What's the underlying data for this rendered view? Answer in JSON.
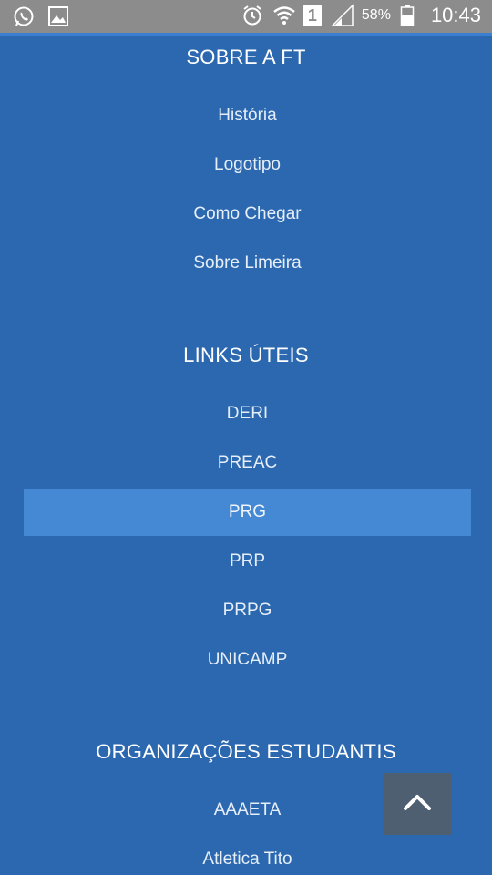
{
  "status_bar": {
    "battery": "58%",
    "time": "10:43",
    "sim": "1",
    "icons_left": [
      "whatsapp-icon",
      "gallery-icon"
    ],
    "icons_right": [
      "alarm-icon",
      "wifi-icon",
      "sim-icon",
      "signal-icon",
      "battery-icon"
    ]
  },
  "sections": {
    "sobre": {
      "title": "SOBRE A FT",
      "items": [
        "História",
        "Logotipo",
        "Como Chegar",
        "Sobre Limeira"
      ]
    },
    "links": {
      "title": "LINKS ÚTEIS",
      "items": [
        "DERI",
        "PREAC",
        "PRG",
        "PRP",
        "PRPG",
        "UNICAMP"
      ],
      "active_index": 2
    },
    "org": {
      "title": "ORGANIZAÇÕES ESTUDANTIS",
      "items": [
        "AAAETA",
        "Atletica Tito"
      ]
    }
  },
  "colors": {
    "background": "#2b68b0",
    "active_item": "#4588d4",
    "status_bar": "#8c8c8c",
    "back_to_top": "#4e5f72"
  },
  "back_to_top_icon": "chevron-up-icon"
}
